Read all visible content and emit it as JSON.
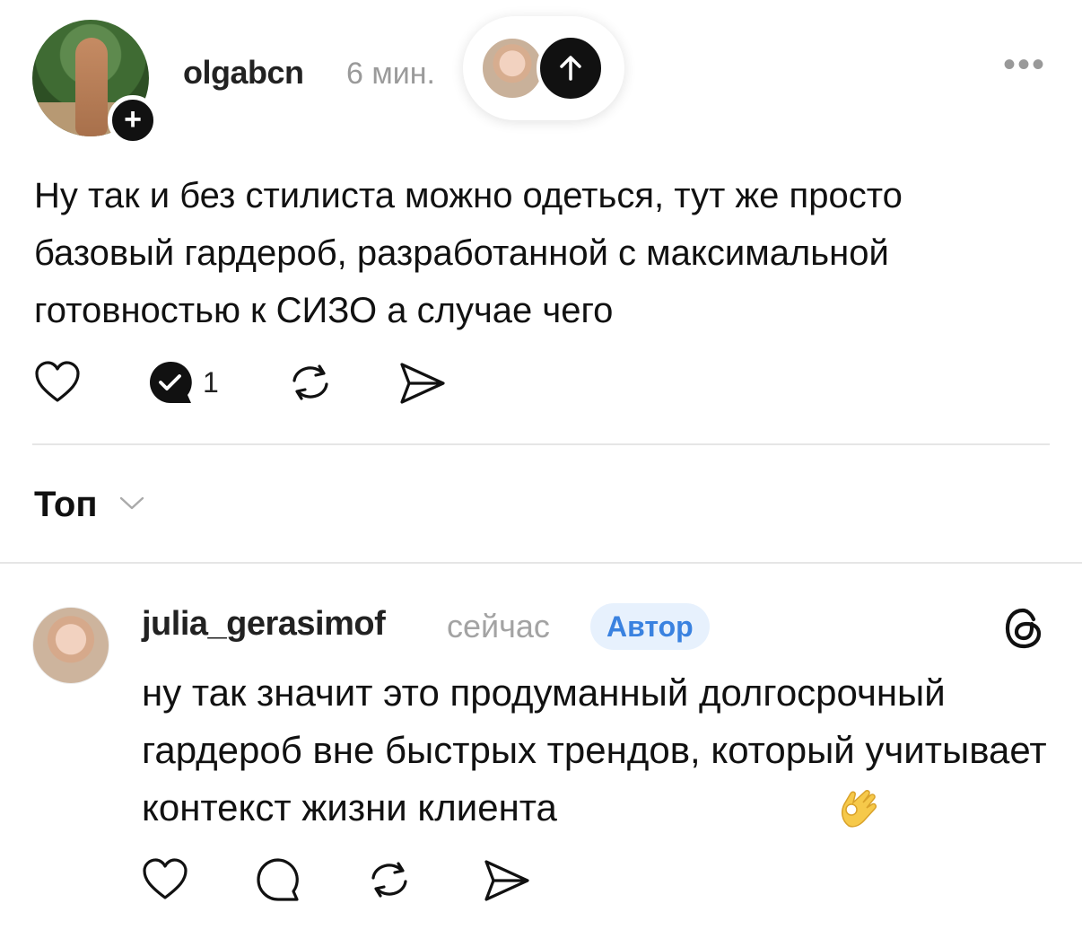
{
  "post": {
    "username": "olgabcn",
    "time": "6 мин.",
    "text": "Ну так и без стилиста можно одеться, тут же просто базовый гардероб, разработанной с максимальной готовностью к СИЗО а случае чего",
    "comment_count": "1",
    "more_label": "•••"
  },
  "sort": {
    "label": "Топ"
  },
  "reply": {
    "username": "julia_gerasimof",
    "time": "сейчас",
    "badge": "Автор",
    "text": "ну так значит это продуманный долгосрочный гардероб вне быстрых трендов, который учитывает контекст жизни клиента"
  },
  "colors": {
    "badge_bg": "#e7f1fd",
    "badge_text": "#3a82e0",
    "muted": "#9a9a9a"
  },
  "icons": [
    "plus-icon",
    "arrow-up-icon",
    "more-icon",
    "heart-icon",
    "comment-check-icon",
    "repost-icon",
    "share-icon",
    "chevron-down-icon",
    "threads-icon",
    "ok-hand-emoji"
  ]
}
